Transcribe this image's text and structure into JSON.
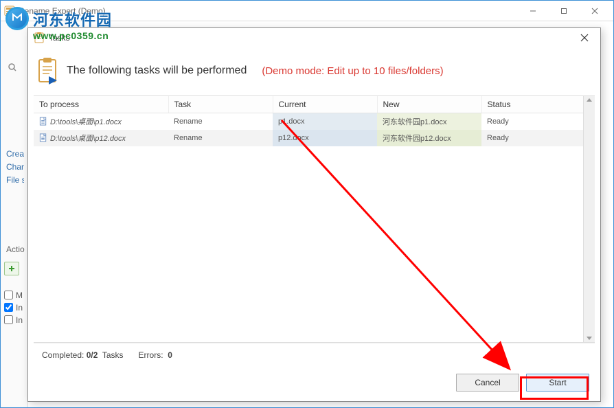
{
  "mainWindow": {
    "title": "Rename Expert (Demo)"
  },
  "watermark": {
    "cn": "河东软件园",
    "url": "www.pc0359.cn"
  },
  "leftPanel": {
    "sidebarLines": [
      "Creat",
      "Chang",
      "File si"
    ],
    "actionsLabel": "Actio",
    "check1": "M",
    "check2": "In",
    "check3": "In"
  },
  "dialog": {
    "title": "Tasks",
    "headerText": "The following tasks will be performed",
    "demoText": "(Demo mode: Edit up to 10 files/folders)",
    "columns": {
      "toProcess": "To process",
      "task": "Task",
      "current": "Current",
      "new_": "New",
      "status": "Status"
    },
    "rows": [
      {
        "path": "D:\\tools\\桌面\\p1.docx",
        "task": "Rename",
        "current": "p1.docx",
        "new_": "河东软件园p1.docx",
        "status": "Ready"
      },
      {
        "path": "D:\\tools\\桌面\\p12.docx",
        "task": "Rename",
        "current": "p12.docx",
        "new_": "河东软件园p12.docx",
        "status": "Ready"
      }
    ],
    "status": {
      "completedLabel": "Completed:",
      "completedValue": "0/2",
      "tasksLabel": "Tasks",
      "errorsLabel": "Errors:",
      "errorsValue": "0"
    },
    "buttons": {
      "cancel": "Cancel",
      "start": "Start"
    }
  }
}
